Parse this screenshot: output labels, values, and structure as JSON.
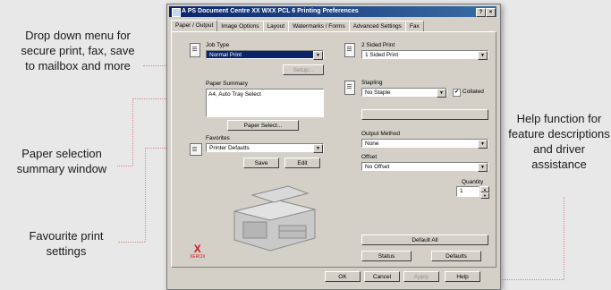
{
  "callouts": {
    "dropdown": "Drop down menu for secure print, fax, save to mailbox and more",
    "paper_summary": "Paper selection summary window",
    "favourite": "Favourite print settings",
    "help": "Help function for feature descriptions and driver assistance"
  },
  "dialog": {
    "title": "A  PS Document Centre XX WXX PCL 6 Printing Preferences",
    "tabs": [
      "Paper / Output",
      "Image Options",
      "Layout",
      "Watermarks / Forms",
      "Advanced Settings",
      "Fax"
    ],
    "job_type_label": "Job Type",
    "job_type_value": "Normal Print",
    "setup_label": "Setup...",
    "paper_summary_label": "Paper Summary",
    "paper_summary_value": "A4, Auto Tray Select",
    "paper_select_label": "Paper Select...",
    "favorites_label": "Favorites",
    "favorites_value": "Printer Defaults",
    "save_label": "Save",
    "edit_label": "Edit",
    "sided_label": "2 Sided Print",
    "sided_value": "1 Sided Print",
    "stapling_label": "Stapling",
    "stapling_value": "No Staple",
    "collated_label": "Collated",
    "collated_checked": "✔",
    "output_method_label": "Output Method",
    "output_method_value": "None",
    "offset_label": "Offset",
    "offset_value": "No Offset",
    "quantity_label": "Quantity",
    "quantity_value": "1",
    "default_all_label": "Default All",
    "status_label": "Status",
    "defaults_label": "Defaults",
    "ok_label": "OK",
    "cancel_label": "Cancel",
    "apply_label": "Apply",
    "help_label": "Help",
    "brand_logo_text": "X",
    "brand_name": "XEROX",
    "close_glyph": "×",
    "help_glyph": "?"
  }
}
